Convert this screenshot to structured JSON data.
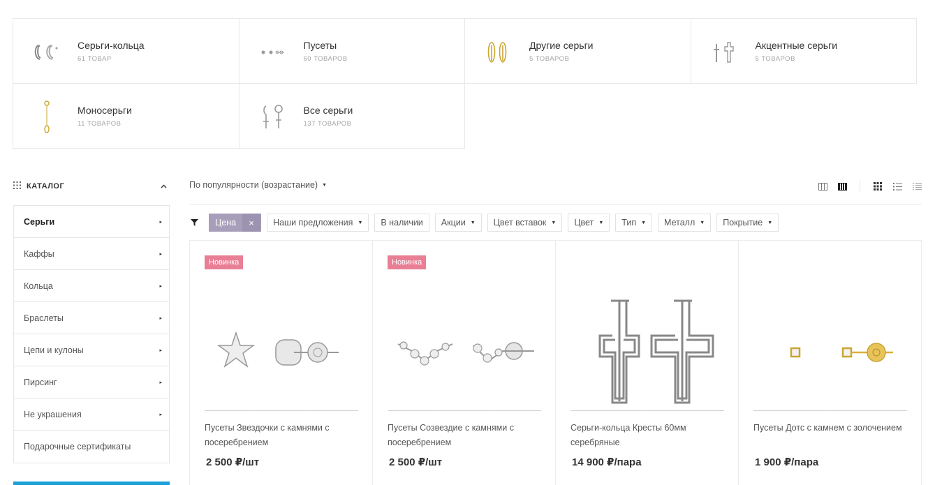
{
  "categories": [
    {
      "name": "Серьги-кольца",
      "count": "61 товар",
      "icon": "hoop-earrings-icon"
    },
    {
      "name": "Пусеты",
      "count": "60 товаров",
      "icon": "stud-earrings-icon"
    },
    {
      "name": "Другие серьги",
      "count": "5 товаров",
      "icon": "pin-earrings-icon"
    },
    {
      "name": "Акцентные серьги",
      "count": "5 товаров",
      "icon": "cross-earrings-icon"
    },
    {
      "name": "Моносерьги",
      "count": "11 товаров",
      "icon": "mono-earring-icon"
    },
    {
      "name": "Все серьги",
      "count": "137 товаров",
      "icon": "all-earrings-icon"
    }
  ],
  "sidebar": {
    "title": "КАТАЛОГ",
    "items": [
      {
        "label": "Серьги",
        "active": true
      },
      {
        "label": "Каффы"
      },
      {
        "label": "Кольца"
      },
      {
        "label": "Браслеты"
      },
      {
        "label": "Цепи и кулоны"
      },
      {
        "label": "Пирсинг"
      },
      {
        "label": "Не украшения"
      },
      {
        "label": "Подарочные сертификаты"
      }
    ]
  },
  "sort": {
    "label": "По популярности (возрастание)"
  },
  "filters": {
    "active": {
      "label": "Цена",
      "remove": "×"
    },
    "chips": [
      "Наши предложения",
      "В наличии",
      "Акции",
      "Цвет вставок",
      "Цвет",
      "Тип",
      "Металл",
      "Покрытие"
    ]
  },
  "products": [
    {
      "badge": "Новинка",
      "name": "Пусеты Звездочки с камнями с посеребрением",
      "price": "2 500 ₽/шт",
      "image": "star-studs-image"
    },
    {
      "badge": "Новинка",
      "name": "Пусеты Созвездие с камнями с посеребрением",
      "price": "2 500 ₽/шт",
      "image": "constellation-studs-image"
    },
    {
      "badge": "",
      "name": "Серьги-кольца Кресты 60мм серебряные",
      "price": "14 900 ₽/пара",
      "image": "cross-hoops-image"
    },
    {
      "badge": "",
      "name": "Пусеты Дотс с камнем с золочением",
      "price": "1 900 ₽/пара",
      "image": "dots-studs-image"
    }
  ],
  "colors": {
    "accent": "#1c9fd7",
    "badge": "#e97f95",
    "filter_active": "#a79fba"
  }
}
